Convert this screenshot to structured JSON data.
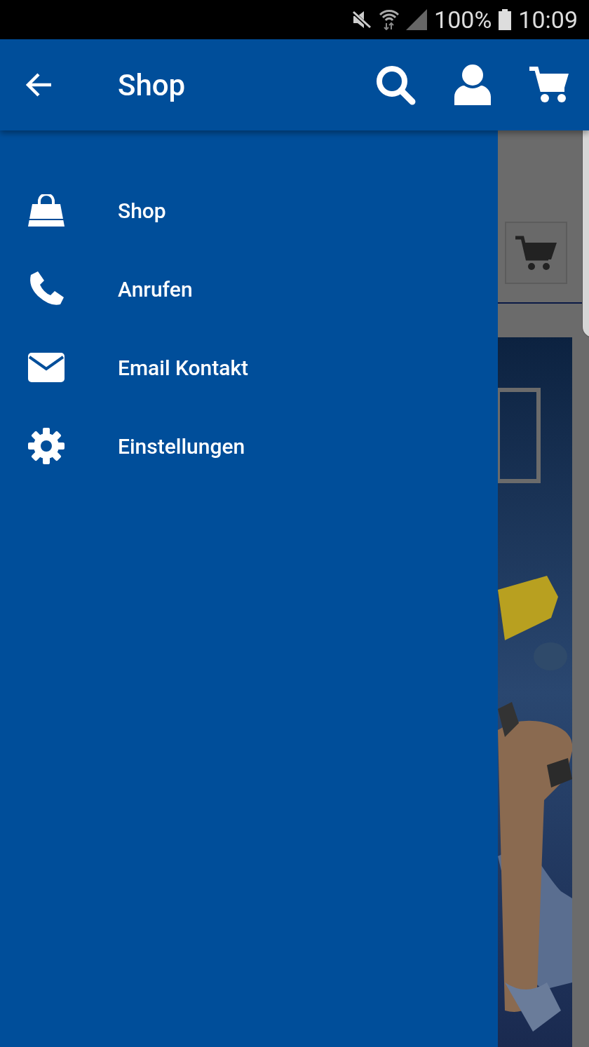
{
  "status_bar": {
    "battery": "100%",
    "time": "10:09"
  },
  "app_bar": {
    "title": "Shop"
  },
  "drawer": {
    "items": [
      {
        "label": "Shop",
        "kind": "bag"
      },
      {
        "label": "Anrufen",
        "kind": "phone"
      },
      {
        "label": "Email Kontakt",
        "kind": "mail"
      },
      {
        "label": "Einstellungen",
        "kind": "gear"
      }
    ]
  }
}
